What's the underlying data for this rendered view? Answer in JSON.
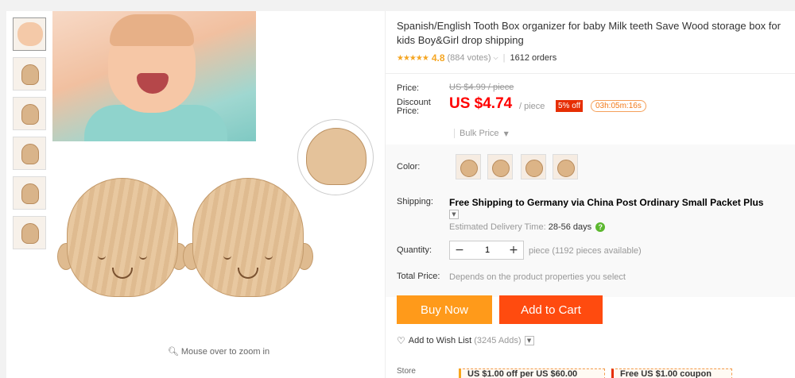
{
  "product": {
    "title": "Spanish/English Tooth Box organizer for baby Milk teeth Save Wood storage box for kids Boy&Girl drop shipping",
    "stars": "★★★★★",
    "rating": "4.8",
    "votes": "(884 votes)",
    "orders": "1612 orders"
  },
  "gallery": {
    "thumb_count": 6,
    "zoom_hint": "Mouse over to zoom in"
  },
  "price": {
    "label": "Price:",
    "original": "US $4.99 / piece",
    "discount_label_line1": "Discount",
    "discount_label_line2": "Price:",
    "current": "US $4.74",
    "unit": "/ piece",
    "discount_badge": "5% off",
    "countdown": "03h:05m:16s",
    "bulk_label": "Bulk Price"
  },
  "options": {
    "color_label": "Color:",
    "swatch_count": 4,
    "shipping_label": "Shipping:",
    "shipping_text": "Free Shipping to Germany via China Post Ordinary Small Packet Plus",
    "delivery_prefix": "Estimated Delivery Time:",
    "delivery_days": "28-56 days",
    "quantity_label": "Quantity:",
    "quantity_value": "1",
    "quantity_note": "piece (1192 pieces available)",
    "total_label": "Total Price:",
    "total_text": "Depends on the product properties you select"
  },
  "actions": {
    "buy_now": "Buy Now",
    "add_to_cart": "Add to Cart",
    "wishlist": "Add to Wish List",
    "wishlist_count": "(3245 Adds)"
  },
  "store": {
    "label": "Store",
    "coupon1": "US $1.00 off per US $60.00",
    "coupon2": "Free US $1.00 coupon"
  },
  "colors": {
    "price_red": "#ff0000",
    "buy_now_orange": "#ff9a1a",
    "add_to_cart_red": "#ff4b0f",
    "star_yellow": "#f5a623",
    "help_green": "#5cb82f"
  }
}
